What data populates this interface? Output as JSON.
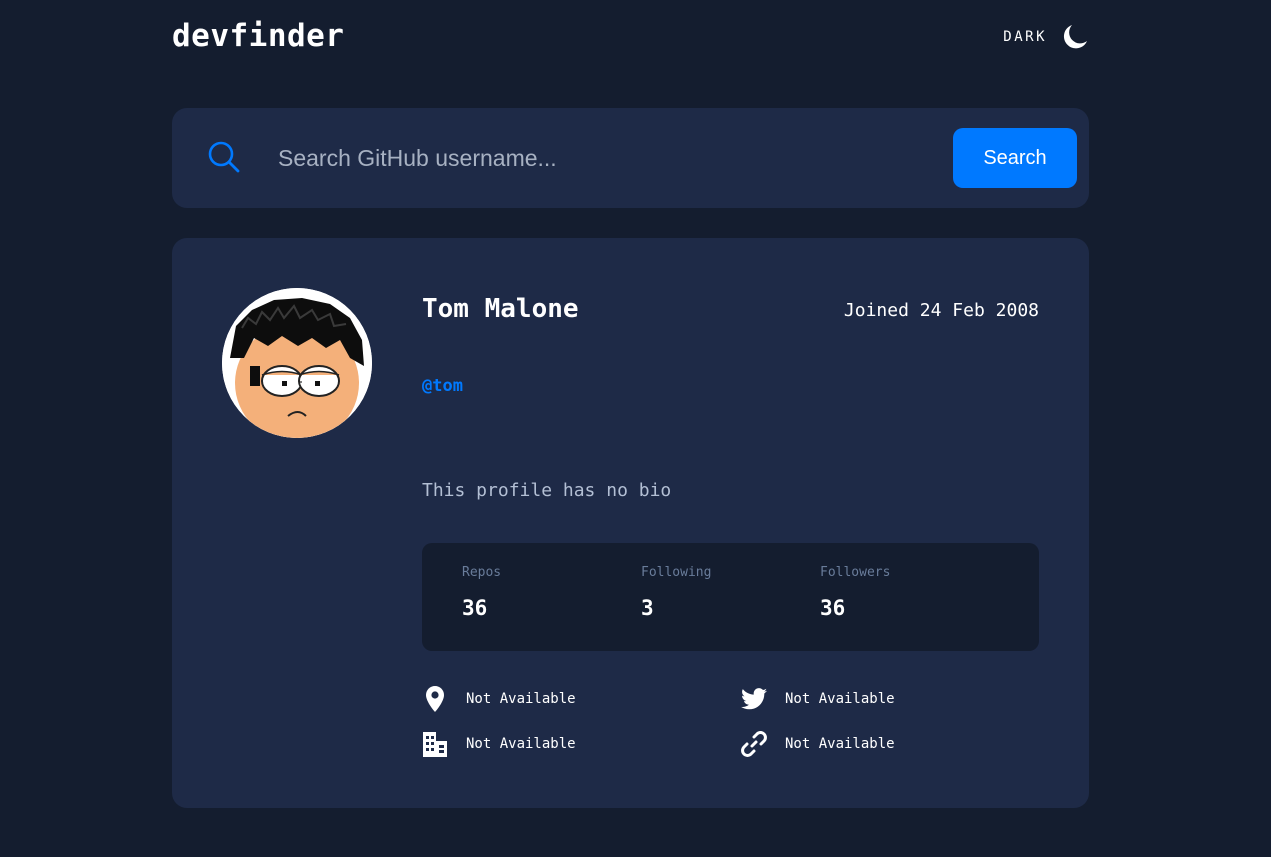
{
  "header": {
    "logo": "devfinder",
    "theme_label": "DARK",
    "theme_icon": "moon-icon"
  },
  "search": {
    "placeholder": "Search GitHub username...",
    "value": "",
    "button_label": "Search",
    "icon": "search-icon"
  },
  "profile": {
    "name": "Tom Malone",
    "joined": "Joined 24 Feb 2008",
    "login": "@tom",
    "bio": "This profile has no bio",
    "stats": [
      {
        "label": "Repos",
        "value": "36"
      },
      {
        "label": "Following",
        "value": "3"
      },
      {
        "label": "Followers",
        "value": "36"
      }
    ],
    "info": {
      "location": {
        "icon": "location-pin-icon",
        "text": "Not Available"
      },
      "twitter": {
        "icon": "twitter-icon",
        "text": "Not Available"
      },
      "company": {
        "icon": "building-icon",
        "text": "Not Available"
      },
      "website": {
        "icon": "link-icon",
        "text": "Not Available"
      }
    }
  },
  "colors": {
    "background": "#141d2f",
    "card": "#1e2a47",
    "accent": "#0079ff",
    "muted": "#697c9a",
    "bio_text": "#b3bfd4"
  }
}
